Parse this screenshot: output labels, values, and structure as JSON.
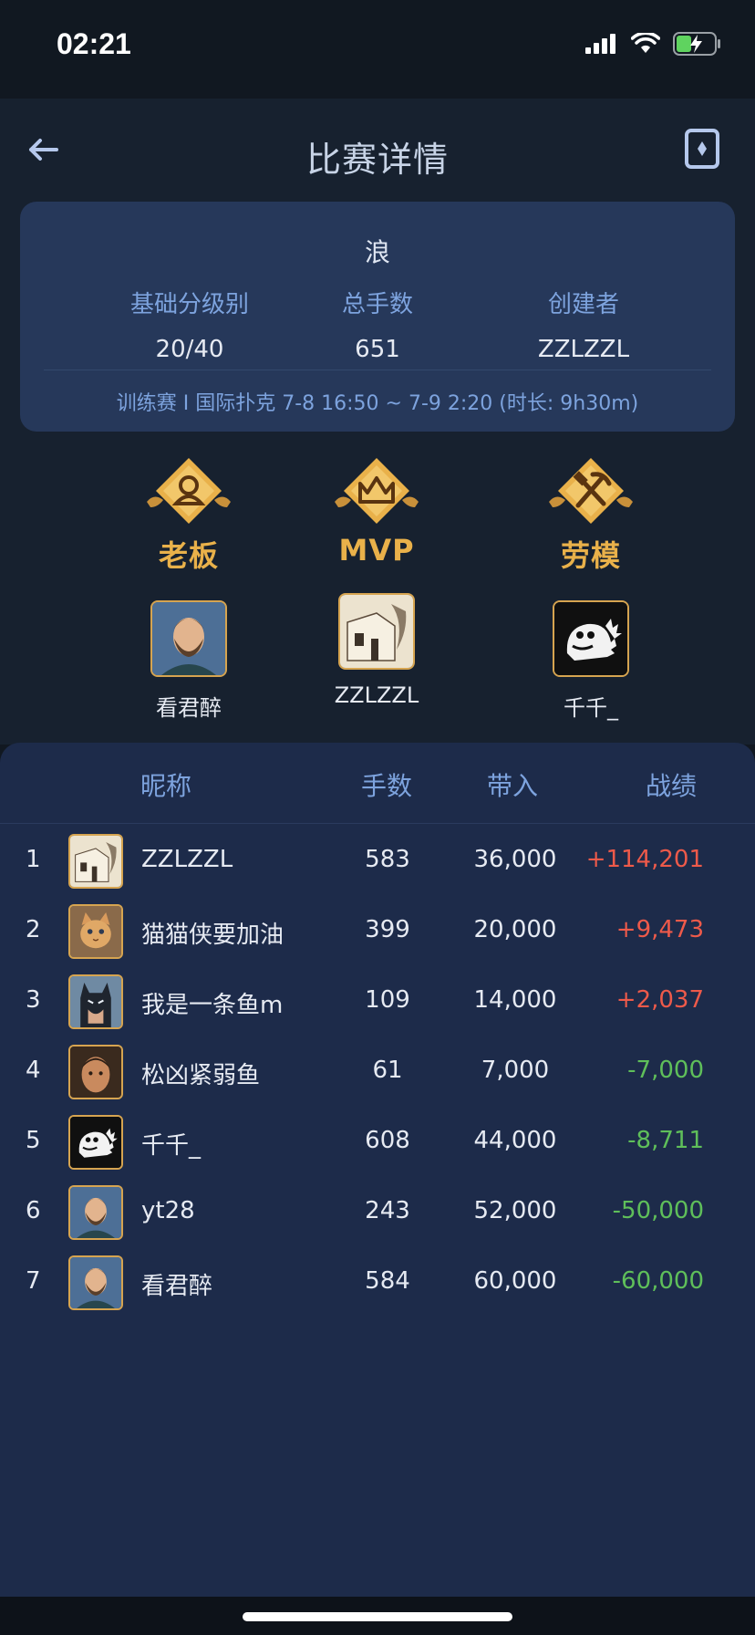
{
  "status_bar": {
    "time": "02:21"
  },
  "header": {
    "title": "比赛详情"
  },
  "info_card": {
    "game_name": "浪",
    "stats": [
      {
        "label": "基础分级别",
        "value": "20/40"
      },
      {
        "label": "总手数",
        "value": "651"
      },
      {
        "label": "创建者",
        "value": "ZZLZZL"
      }
    ],
    "meta": "训练赛 I 国际扑克  7-8 16:50 ~ 7-9 2:20 (时长: 9h30m)"
  },
  "awards": [
    {
      "title": "老板",
      "icon": "boss-icon",
      "player": "看君醉",
      "avatar": "bearded-man-avatar"
    },
    {
      "title": "MVP",
      "icon": "crown-icon",
      "player": "ZZLZZL",
      "avatar": "sketch-avatar"
    },
    {
      "title": "劳模",
      "icon": "hammer-pickaxe-icon",
      "player": "千千_",
      "avatar": "dinosaur-avatar"
    }
  ],
  "table": {
    "columns": {
      "nickname": "昵称",
      "hands": "手数",
      "buyin": "带入",
      "result": "战绩"
    },
    "rows": [
      {
        "rank": "1",
        "nick": "ZZLZZL",
        "hands": "583",
        "buyin": "36,000",
        "result": "+114,201",
        "avatar": "sketch-avatar"
      },
      {
        "rank": "2",
        "nick": "猫猫侠要加油",
        "hands": "399",
        "buyin": "20,000",
        "result": "+9,473",
        "avatar": "cat-avatar"
      },
      {
        "rank": "3",
        "nick": "我是一条鱼m",
        "hands": "109",
        "buyin": "14,000",
        "result": "+2,037",
        "avatar": "batman-avatar"
      },
      {
        "rank": "4",
        "nick": "松凶紧弱鱼",
        "hands": "61",
        "buyin": "7,000",
        "result": "-7,000",
        "avatar": "portrait-avatar"
      },
      {
        "rank": "5",
        "nick": "千千_",
        "hands": "608",
        "buyin": "44,000",
        "result": "-8,711",
        "avatar": "dinosaur-avatar"
      },
      {
        "rank": "6",
        "nick": "yt28",
        "hands": "243",
        "buyin": "52,000",
        "result": "-50,000",
        "avatar": "bearded-man-avatar"
      },
      {
        "rank": "7",
        "nick": "看君醉",
        "hands": "584",
        "buyin": "60,000",
        "result": "-60,000",
        "avatar": "bearded-man-avatar"
      }
    ]
  },
  "colors": {
    "positive": "#ee5a4a",
    "negative": "#5fbf5a",
    "accent_gold": "#e9b14a",
    "label_blue": "#7da3de"
  }
}
